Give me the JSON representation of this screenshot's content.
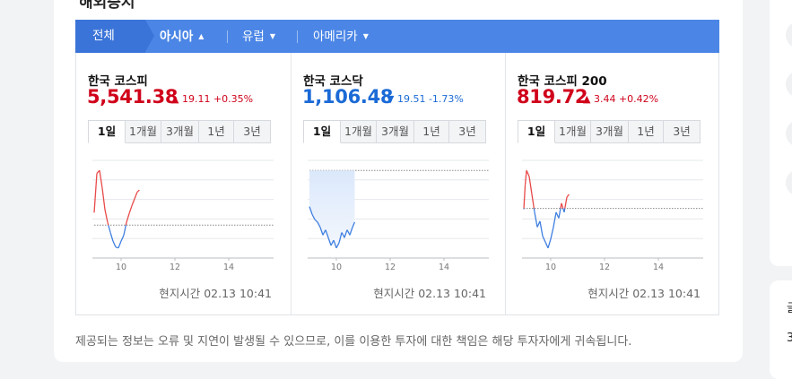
{
  "section": {
    "title": "해외증시",
    "tabs": [
      {
        "label": "전체",
        "caret": ""
      },
      {
        "label": "아시아",
        "caret": "▲"
      },
      {
        "label": "유럽",
        "caret": "▼"
      },
      {
        "label": "아메리카",
        "caret": "▼"
      }
    ]
  },
  "panels": [
    {
      "name": "한국 코스피",
      "value": "5,541.38",
      "direction": "up",
      "change": "▲ 19.11 +0.35%",
      "periods": [
        "1일",
        "1개월",
        "3개월",
        "1년",
        "3년"
      ],
      "active_period": "1일",
      "time_label": "현지시간 02.13 10:41",
      "chart_data": {
        "type": "line",
        "x_ticks": [
          "10",
          "12",
          "14"
        ],
        "x": [
          9.0,
          9.1,
          9.2,
          9.3,
          9.4,
          9.5,
          9.6,
          9.7,
          9.8,
          9.9,
          10.0,
          10.1,
          10.2,
          10.3,
          10.4,
          10.5,
          10.6,
          10.68
        ],
        "y": [
          5535,
          5575,
          5578,
          5560,
          5538,
          5525,
          5515,
          5506,
          5500,
          5499,
          5506,
          5512,
          5525,
          5534,
          5542,
          5549,
          5556,
          5558
        ],
        "baseline": 5522.27,
        "up_color": "#e84a4a",
        "down_color": "#3f7fe0"
      }
    },
    {
      "name": "한국 코스닥",
      "value": "1,106.48",
      "direction": "down",
      "change": "▼ 19.51 -1.73%",
      "periods": [
        "1일",
        "1개월",
        "3개월",
        "1년",
        "3년"
      ],
      "active_period": "1일",
      "time_label": "현지시간 02.13 10:41",
      "chart_data": {
        "type": "area",
        "x_ticks": [
          "10",
          "12",
          "14"
        ],
        "x": [
          9.0,
          9.1,
          9.2,
          9.3,
          9.4,
          9.5,
          9.6,
          9.7,
          9.8,
          9.9,
          10.0,
          10.1,
          10.2,
          10.3,
          10.4,
          10.5,
          10.6,
          10.68
        ],
        "y": [
          1112,
          1109,
          1107,
          1106,
          1104,
          1101,
          1103,
          1100,
          1097,
          1099,
          1096,
          1098,
          1102,
          1100,
          1103,
          1101,
          1104,
          1106
        ],
        "baseline": 1125.99,
        "up_color": "#e84a4a",
        "down_color": "#3f7fe0"
      }
    },
    {
      "name": "한국 코스피 200",
      "value": "819.72",
      "direction": "up",
      "change": "▲ 3.44 +0.42%",
      "periods": [
        "1일",
        "1개월",
        "3개월",
        "1년",
        "3년"
      ],
      "active_period": "1일",
      "time_label": "현지시간 02.13 10:41",
      "chart_data": {
        "type": "line",
        "x_ticks": [
          "10",
          "12",
          "14"
        ],
        "x": [
          9.0,
          9.05,
          9.1,
          9.2,
          9.3,
          9.4,
          9.5,
          9.6,
          9.7,
          9.8,
          9.9,
          10.0,
          10.1,
          10.2,
          10.3,
          10.4,
          10.5,
          10.6,
          10.68
        ],
        "y": [
          816,
          824,
          829,
          827,
          821,
          815,
          810,
          812,
          807,
          805,
          803,
          806,
          810,
          815,
          813,
          818,
          815,
          820,
          821
        ],
        "baseline": 816.28,
        "up_color": "#e84a4a",
        "down_color": "#3f7fe0"
      }
    }
  ],
  "notice": "제공되는 정보는 오류 및 지연이 발생될 수 있으므로, 이를 이용한 투자에 대한 책임은 해당 투자자에게 귀속됩니다.",
  "side": {
    "text_1": "글",
    "text_2": "3"
  }
}
